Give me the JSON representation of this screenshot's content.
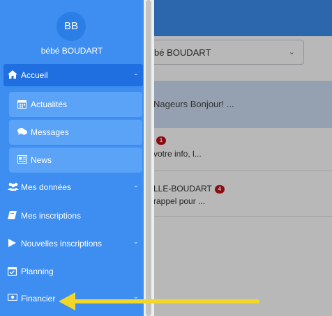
{
  "user": {
    "initials": "BB",
    "name": "bébé BOUDART"
  },
  "background": {
    "select_value": "bé BOUDART",
    "row1_text": "Nageurs Bonjour! ...",
    "row2_line1_badge": "1",
    "row2_line2": "votre info, l...",
    "row3_title": "LLE-BOUDART",
    "row3_badge": "4",
    "row3_line2": "rappel pour ..."
  },
  "sidebar": {
    "accueil": {
      "label": "Accueil",
      "icon": "home-icon"
    },
    "sub_items": [
      {
        "label": "Actualités",
        "icon": "calendar-icon"
      },
      {
        "label": "Messages",
        "icon": "chat-icon"
      },
      {
        "label": "News",
        "icon": "newspaper-icon"
      }
    ],
    "items": [
      {
        "label": "Mes données",
        "icon": "users-icon",
        "has_chevron": true
      },
      {
        "label": "Mes inscriptions",
        "icon": "book-icon",
        "has_chevron": false
      },
      {
        "label": "Nouvelles inscriptions",
        "icon": "play-icon",
        "has_chevron": true
      },
      {
        "label": "Planning",
        "icon": "calendar-check-icon",
        "has_chevron": false
      },
      {
        "label": "Financier",
        "icon": "money-icon",
        "has_chevron": true
      }
    ]
  },
  "colors": {
    "primary": "#3d8ef0",
    "active": "#1f6fe0",
    "sub_item": "#5ba3f7",
    "badge": "#c0121d",
    "arrow": "#f2d629"
  }
}
